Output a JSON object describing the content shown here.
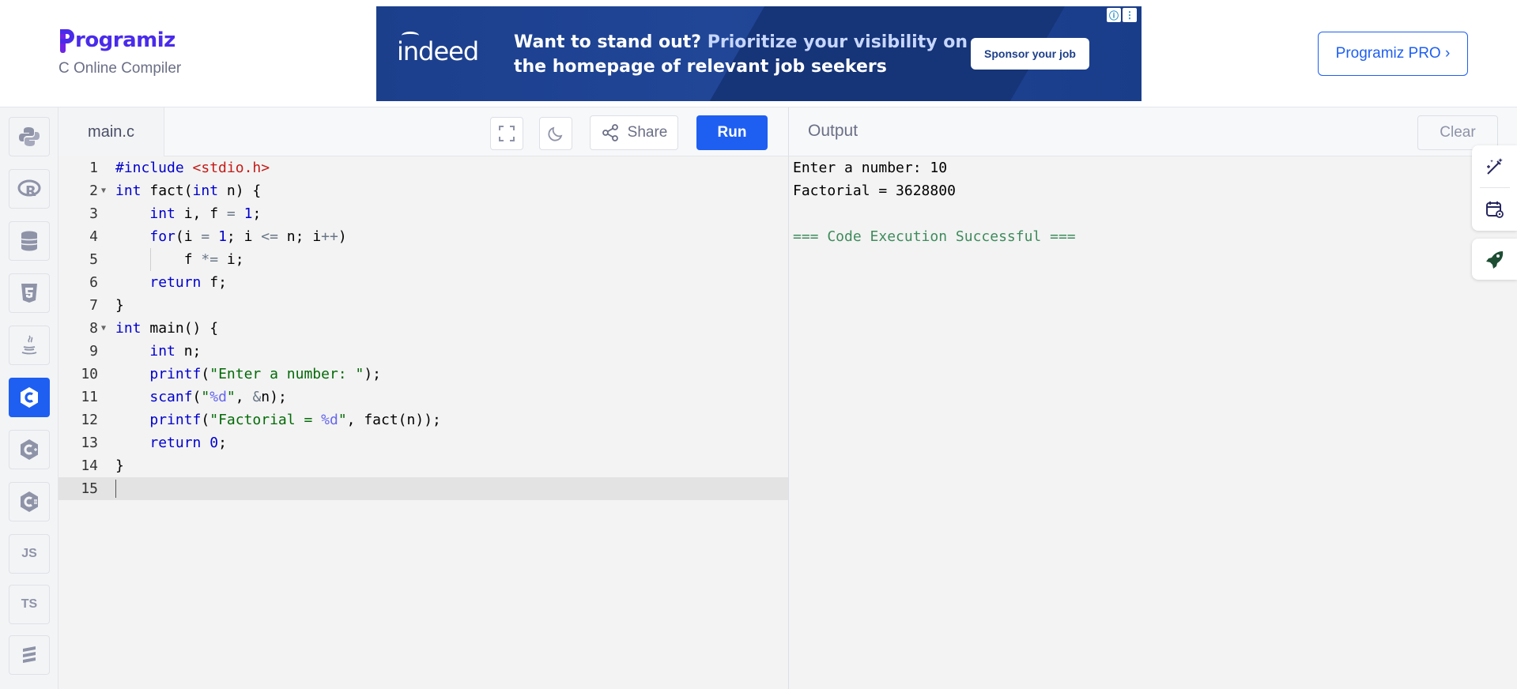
{
  "header": {
    "brand_name": "rogramiz",
    "brand_subtitle": "C Online Compiler",
    "pro_button": "Programiz PRO ›"
  },
  "ad": {
    "logo": "indeed",
    "headline_white": "Want to stand out?",
    "headline_highlight": "Prioritize your visibility on",
    "headline_line2": "the homepage of relevant job seekers",
    "button": "Sponsor your job"
  },
  "sidebar": {
    "items": [
      {
        "name": "python",
        "icon": "python-icon"
      },
      {
        "name": "r",
        "icon": "r-icon"
      },
      {
        "name": "sql",
        "icon": "database-icon"
      },
      {
        "name": "html",
        "icon": "html5-icon"
      },
      {
        "name": "java",
        "icon": "java-icon"
      },
      {
        "name": "c",
        "icon": "c-icon",
        "active": true
      },
      {
        "name": "cpp",
        "icon": "cpp-icon"
      },
      {
        "name": "csharp",
        "icon": "csharp-icon"
      },
      {
        "name": "js",
        "label": "JS"
      },
      {
        "name": "ts",
        "label": "TS"
      },
      {
        "name": "more",
        "icon": "stack-icon"
      }
    ]
  },
  "editor": {
    "file_tab": "main.c",
    "share_label": "Share",
    "run_label": "Run",
    "line_numbers": [
      "1",
      "2",
      "3",
      "4",
      "5",
      "6",
      "7",
      "8",
      "9",
      "10",
      "11",
      "12",
      "13",
      "14",
      "15"
    ]
  },
  "output": {
    "title": "Output",
    "clear_label": "Clear",
    "lines": [
      "Enter a number: 10",
      "Factorial = 3628800",
      "",
      "=== Code Execution Successful ==="
    ]
  },
  "colors": {
    "accent": "#1e5ff2",
    "brand": "#4a2bea",
    "success": "#3e8b5c"
  }
}
